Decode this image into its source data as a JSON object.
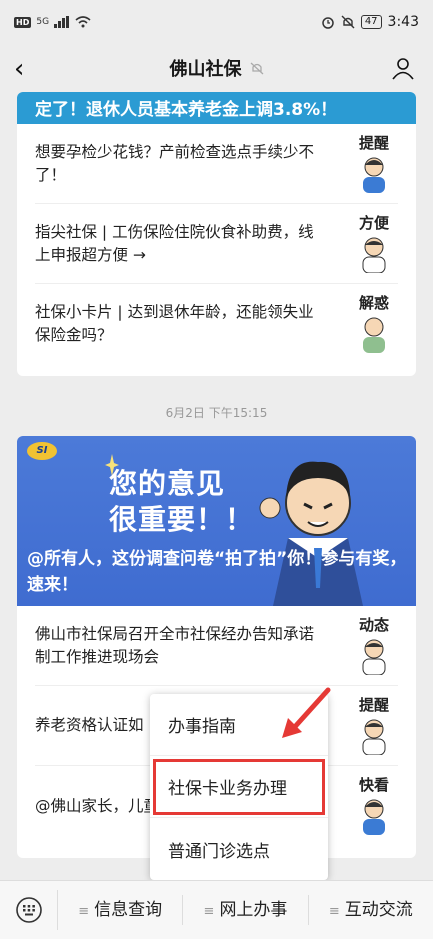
{
  "status": {
    "hd": "HD",
    "signal": "5G",
    "battery": "47",
    "time": "3:43"
  },
  "nav": {
    "title": "佛山社保"
  },
  "card1": {
    "banner": "定了！退休人员基本养老金上调3.8%！",
    "items": [
      {
        "text": "想要孕检少花钱？产前检查选点手续少不了！",
        "tag": "提醒"
      },
      {
        "text": "指尖社保 | 工伤保险住院伙食补助费，线上申报超方便 →",
        "tag": "方便"
      },
      {
        "text": "社保小卡片 | 达到退休年龄，还能领失业保险金吗？",
        "tag": "解惑"
      }
    ]
  },
  "date": "6月2日 下午15:15",
  "card2": {
    "hero_title_line1": "您的意见",
    "hero_title_line2": "很重要！！",
    "hero_subtitle": "@所有人，这份调查问卷“拍了拍”你！参与有奖，速来！",
    "logo": "SI",
    "items": [
      {
        "text": "佛山市社保局召开全市社保经办告知承诺制工作推进现场会",
        "tag": "动态"
      },
      {
        "text": "养老资格认证如",
        "tag": "提醒"
      },
      {
        "text": "@佛山家长，儿童南请收好！",
        "tag": "快看"
      }
    ]
  },
  "menu": {
    "items": [
      "办事指南",
      "社保卡业务办理",
      "普通门诊选点"
    ]
  },
  "bottom": {
    "tabs": [
      "信息查询",
      "网上办事",
      "互动交流"
    ]
  },
  "colors": {
    "accent_red": "#e53935",
    "hero_blue": "#4c7ad8"
  }
}
